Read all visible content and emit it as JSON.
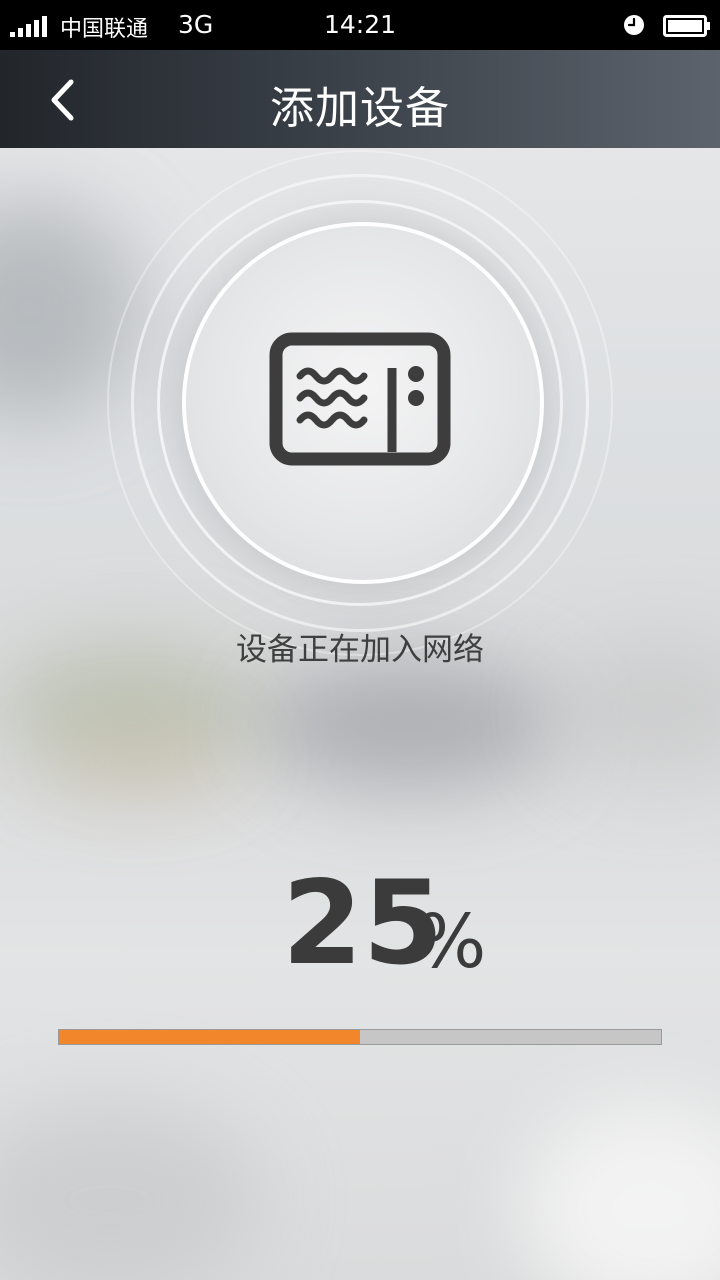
{
  "status_bar": {
    "carrier": "中国联通",
    "network": "3G",
    "time": "14:21",
    "icons": [
      "signal-icon",
      "alarm-icon",
      "battery-icon"
    ]
  },
  "header": {
    "title": "添加设备",
    "back_icon": "chevron-left-icon"
  },
  "device": {
    "icon": "microwave-icon",
    "status_text": "设备正在加入网络"
  },
  "progress": {
    "value": "25",
    "unit": "%",
    "fraction": 0.5
  },
  "colors": {
    "accent": "#f2862a",
    "track": "#c6c6c6",
    "title_bar": "#3a4048",
    "icon": "#3d3d3d"
  }
}
